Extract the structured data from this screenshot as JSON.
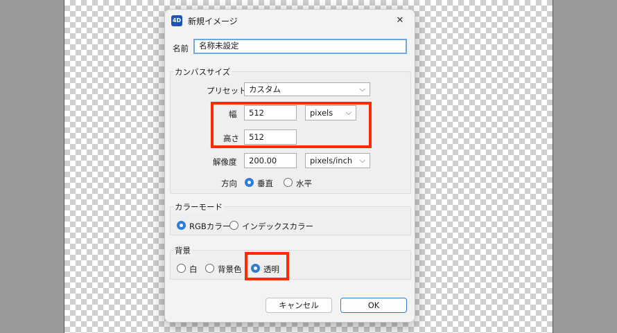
{
  "dialog": {
    "icon_label": "4D",
    "title": "新規イメージ",
    "close_label": "✕",
    "name_label": "名前",
    "name_value": "名称未設定",
    "canvas_size": {
      "title": "カンバスサイズ",
      "preset_label": "プリセット",
      "preset_value": "カスタム",
      "width_label": "幅",
      "width_value": "512",
      "unit_value": "pixels",
      "height_label": "高さ",
      "height_value": "512",
      "resolution_label": "解像度",
      "resolution_value": "200.00",
      "resolution_unit": "pixels/inch",
      "orientation_label": "方向",
      "orientation_options": [
        "垂直",
        "水平"
      ],
      "orientation_selected": "垂直"
    },
    "color_mode": {
      "title": "カラーモード",
      "options": [
        "RGBカラー",
        "インデックスカラー"
      ],
      "selected": "RGBカラー"
    },
    "background": {
      "title": "背景",
      "options": [
        "白",
        "背景色",
        "透明"
      ],
      "selected": "透明"
    },
    "cancel_label": "キャンセル",
    "ok_label": "OK"
  },
  "colors": {
    "highlight": "#ff2a00",
    "accent": "#2f7bd6"
  }
}
